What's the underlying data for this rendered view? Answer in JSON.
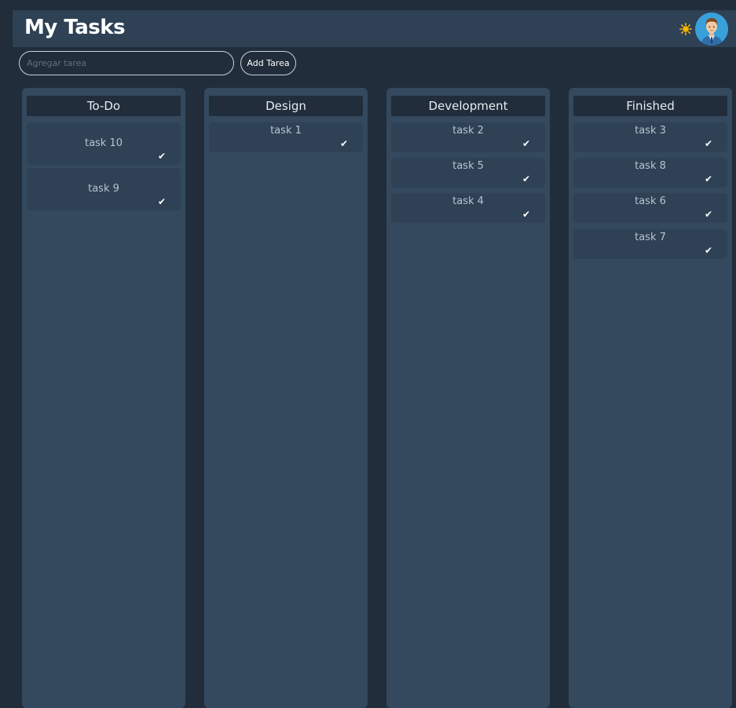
{
  "header": {
    "title": "My Tasks",
    "theme_icon": "sun-icon",
    "avatar_icon": "user-avatar-icon"
  },
  "new_task": {
    "placeholder": "Agregar tarea",
    "value": "",
    "button_label": "Add Tarea"
  },
  "columns": [
    {
      "title": "To-Do",
      "tasks": [
        {
          "label": "task 10"
        },
        {
          "label": "task 9"
        }
      ]
    },
    {
      "title": "Design",
      "tasks": [
        {
          "label": "task 1"
        }
      ]
    },
    {
      "title": "Development",
      "tasks": [
        {
          "label": "task 2"
        },
        {
          "label": "task 5"
        },
        {
          "label": "task 4"
        }
      ]
    },
    {
      "title": "Finished",
      "tasks": [
        {
          "label": "task 3"
        },
        {
          "label": "task 8"
        },
        {
          "label": "task 6"
        },
        {
          "label": "task 7"
        }
      ]
    }
  ],
  "check_glyph": "✔",
  "colors": {
    "background": "#212d3a",
    "header": "#2e4155",
    "column": "#34495e",
    "card": "#2e4155",
    "sun": "#f5b800",
    "avatar": "#3aa0dc"
  }
}
